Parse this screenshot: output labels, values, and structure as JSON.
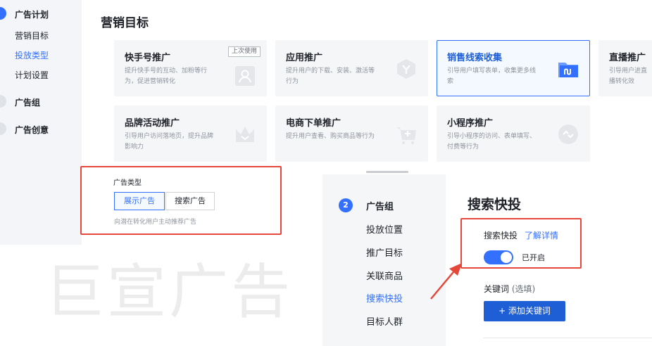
{
  "sidebar": {
    "plan_title": "广告计划",
    "plan_items": [
      {
        "label": "营销目标",
        "active": false
      },
      {
        "label": "投放类型",
        "active": true
      },
      {
        "label": "计划设置",
        "active": false
      }
    ],
    "group_title": "广告组",
    "creative_title": "广告创意"
  },
  "marketing": {
    "title": "营销目标",
    "cards": [
      {
        "title": "快手号推广",
        "desc": "提升快手号的互动、加粉等行为，促进营销转化",
        "badge": "上次使用",
        "icon": "user-icon"
      },
      {
        "title": "应用推广",
        "desc": "提升用户的下载、安装、激活等行为",
        "icon": "app-icon"
      },
      {
        "title": "销售线索收集",
        "desc": "引导用户填写表单，收集更多线索",
        "icon": "folder-icon"
      },
      {
        "title": "直播推广",
        "desc": "引导用户进直播转化效",
        "icon": "live-icon"
      },
      {
        "title": "品牌活动推广",
        "desc": "引导用户访问落地页，提升品牌影响力",
        "icon": "crown-icon"
      },
      {
        "title": "电商下单推广",
        "desc": "提升用户查看、购买商品等行为",
        "icon": "cart-icon"
      },
      {
        "title": "小程序推广",
        "desc": "引导小程序的访问、表单填写、付费等行为",
        "icon": "miniprogram-icon"
      }
    ]
  },
  "ad_type": {
    "label": "广告类型",
    "options": [
      "展示广告",
      "搜索广告"
    ],
    "selected": "展示广告",
    "desc": "向潜在转化用户主动推荐广告"
  },
  "watermark": "巨宣广告",
  "nav2": {
    "step_number": "2",
    "group_title": "广告组",
    "items": [
      {
        "label": "投放位置",
        "active": false
      },
      {
        "label": "推广目标",
        "active": false
      },
      {
        "label": "关联商品",
        "active": false
      },
      {
        "label": "搜索快投",
        "active": true
      },
      {
        "label": "目标人群",
        "active": false
      }
    ]
  },
  "search_quick": {
    "title": "搜索快投",
    "label": "搜索快投",
    "link": "了解详情",
    "toggle_on": true,
    "toggle_text": "已开启",
    "keyword_label": "关键词",
    "keyword_optional": "(选填)",
    "add_button": "+ 添加关键词"
  },
  "colors": {
    "accent": "#3370ff",
    "highlight_red": "#e5483b",
    "sidebar_bg": "#f3f5f9",
    "card_bg": "#f5f6f8"
  }
}
